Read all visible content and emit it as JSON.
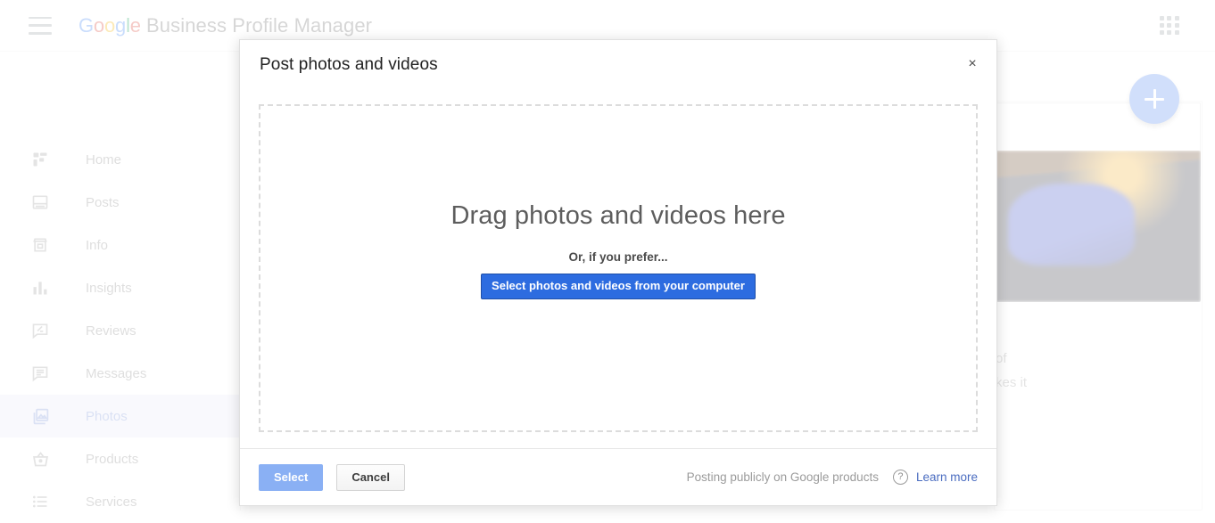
{
  "header": {
    "menu_icon": "hamburger-menu-icon",
    "brand_google": "Google",
    "brand_suffix": " Business Profile Manager",
    "apps_icon": "google-apps-grid-icon"
  },
  "sidebar": {
    "items": [
      {
        "label": "Home",
        "icon": "dashboard-icon",
        "active": false
      },
      {
        "label": "Posts",
        "icon": "posts-icon",
        "active": false
      },
      {
        "label": "Info",
        "icon": "storefront-icon",
        "active": false
      },
      {
        "label": "Insights",
        "icon": "bar-chart-icon",
        "active": false
      },
      {
        "label": "Reviews",
        "icon": "review-edit-icon",
        "active": false
      },
      {
        "label": "Messages",
        "icon": "message-icon",
        "active": false
      },
      {
        "label": "Photos",
        "icon": "photo-library-icon",
        "active": true
      },
      {
        "label": "Products",
        "icon": "basket-icon",
        "active": false
      },
      {
        "label": "Services",
        "icon": "list-icon",
        "active": false
      }
    ]
  },
  "background": {
    "add_button_icon": "plus-icon",
    "card_text_line1": "of",
    "card_text_line2": "kes it"
  },
  "dialog": {
    "title": "Post photos and videos",
    "close_label": "×",
    "dropzone": {
      "headline": "Drag photos and videos here",
      "subtext": "Or, if you prefer...",
      "button_label": "Select photos and videos from your computer"
    },
    "footer": {
      "select_label": "Select",
      "cancel_label": "Cancel",
      "note": "Posting publicly on Google products",
      "help_icon": "help-question-icon",
      "learn_more_label": "Learn more"
    }
  },
  "colors": {
    "accent_blue": "#4285F4",
    "button_blue": "#2d6ce0",
    "select_disabled_blue": "#8ab0f4",
    "active_nav_bg": "#e8eaf6",
    "active_nav_text": "#7c93d8"
  }
}
